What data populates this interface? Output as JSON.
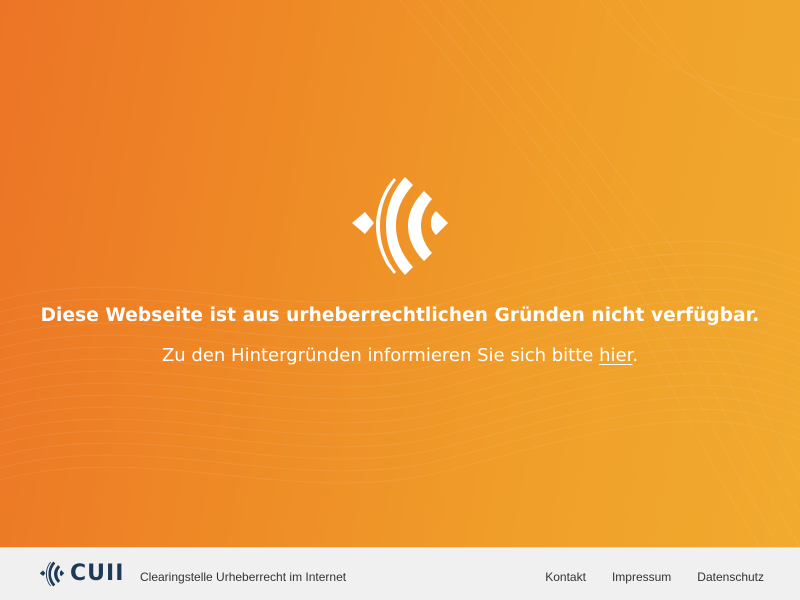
{
  "hero": {
    "headline": "Diese Webseite ist aus urheberrechtlichen Gründen nicht verfügbar.",
    "subline_prefix": "Zu den Hintergründen informieren Sie sich bitte ",
    "subline_link": "hier",
    "subline_suffix": ".",
    "logo_icon": "cuii-signal-icon"
  },
  "footer": {
    "brand": "CUII",
    "tagline": "Clearingstelle Urheberrecht im Internet",
    "links": [
      "Kontakt",
      "Impressum",
      "Datenschutz"
    ]
  },
  "colors": {
    "gradient_start": "#ec7426",
    "gradient_end": "#f1aa2e",
    "text_on_hero": "#ffffff",
    "footer_bg": "#f0f0f0",
    "brand_navy": "#1f3a57"
  }
}
